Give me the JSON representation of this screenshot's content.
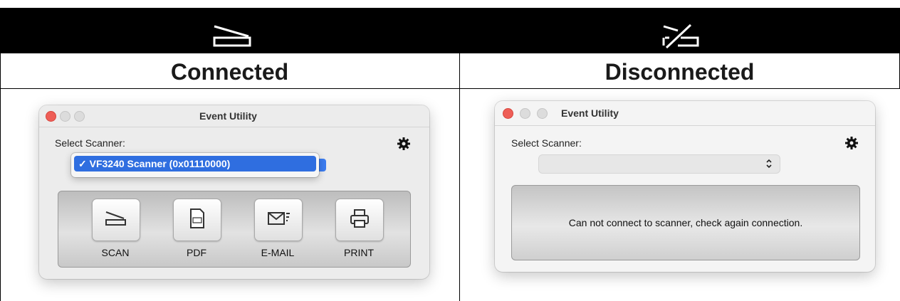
{
  "columns": {
    "left": {
      "title": "Connected",
      "header_icon": "scanner-icon"
    },
    "right": {
      "title": "Disconnected",
      "header_icon": "scanner-disconnected-icon"
    }
  },
  "connected_window": {
    "title": "Event Utility",
    "select_label": "Select Scanner:",
    "dropdown_option": "✓ VF3240 Scanner (0x01110000)",
    "buttons": [
      {
        "label": "SCAN",
        "icon": "scanner-icon"
      },
      {
        "label": "PDF",
        "icon": "pdf-icon"
      },
      {
        "label": "E-MAIL",
        "icon": "mail-icon"
      },
      {
        "label": "PRINT",
        "icon": "printer-icon"
      }
    ],
    "settings_icon": "gear-icon"
  },
  "disconnected_window": {
    "title": "Event Utility",
    "select_label": "Select Scanner:",
    "select_value": "",
    "message": "Can not connect to scanner, check again connection.",
    "settings_icon": "gear-icon"
  },
  "colors": {
    "header_bg": "#000000",
    "close_button": "#ee5e57",
    "selection": "#2f6ee0"
  }
}
